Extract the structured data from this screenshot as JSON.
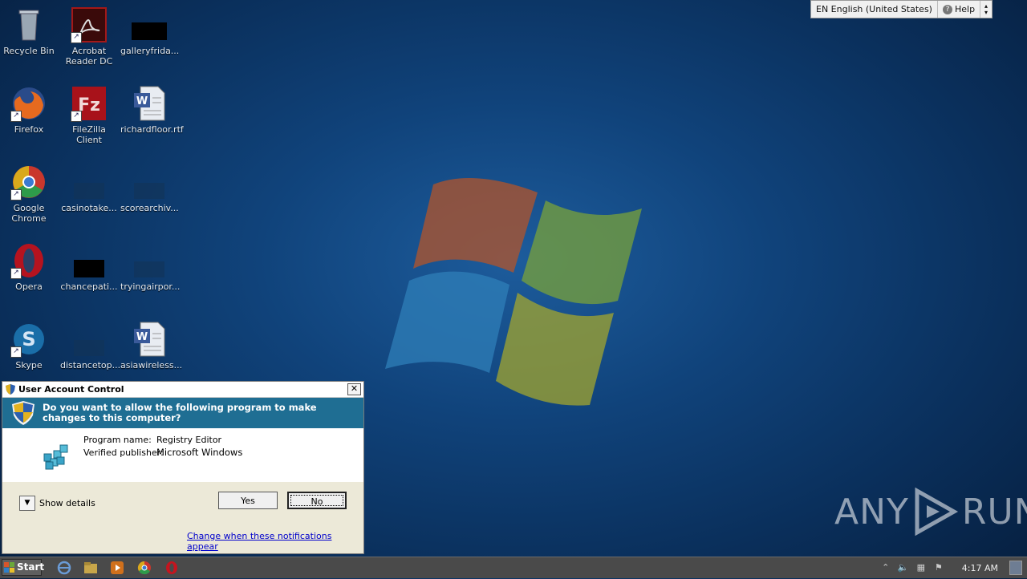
{
  "desktop": {
    "icons": [
      {
        "label": "Recycle Bin",
        "icon": "recycle-bin-icon"
      },
      {
        "label": "Acrobat Reader DC",
        "icon": "acrobat-icon"
      },
      {
        "label": "galleryfrida...",
        "icon": "file-icon"
      },
      {
        "label": "Firefox",
        "icon": "firefox-icon"
      },
      {
        "label": "FileZilla Client",
        "icon": "filezilla-icon"
      },
      {
        "label": "richardfloor.rtf",
        "icon": "word-doc-icon"
      },
      {
        "label": "Google Chrome",
        "icon": "chrome-icon"
      },
      {
        "label": "casinotake...",
        "icon": "file-icon"
      },
      {
        "label": "scorearchiv...",
        "icon": "file-icon"
      },
      {
        "label": "Opera",
        "icon": "opera-icon"
      },
      {
        "label": "chancepati...",
        "icon": "file-icon"
      },
      {
        "label": "tryingairpor...",
        "icon": "file-icon"
      },
      {
        "label": "Skype",
        "icon": "skype-icon"
      },
      {
        "label": "distancetop...",
        "icon": "file-icon"
      },
      {
        "label": "asiawireless...",
        "icon": "word-doc-icon"
      }
    ]
  },
  "langbar": {
    "language": "EN English (United States)",
    "help": "Help"
  },
  "uac": {
    "title": "User Account Control",
    "question": "Do you want to allow the following program to make changes to this computer?",
    "program_name_label": "Program name:",
    "program_name_value": "Registry Editor",
    "publisher_label": "Verified publisher:",
    "publisher_value": "Microsoft Windows",
    "show_details": "Show details",
    "yes": "Yes",
    "no": "No",
    "change_link": "Change when these notifications appear"
  },
  "watermark": {
    "left": "ANY",
    "right": "RUN"
  },
  "taskbar": {
    "start": "Start",
    "clock": "4:17 AM"
  },
  "colors": {
    "banner": "#1f6e93",
    "taskbar": "#4a4a4a",
    "link": "#0000cc"
  }
}
